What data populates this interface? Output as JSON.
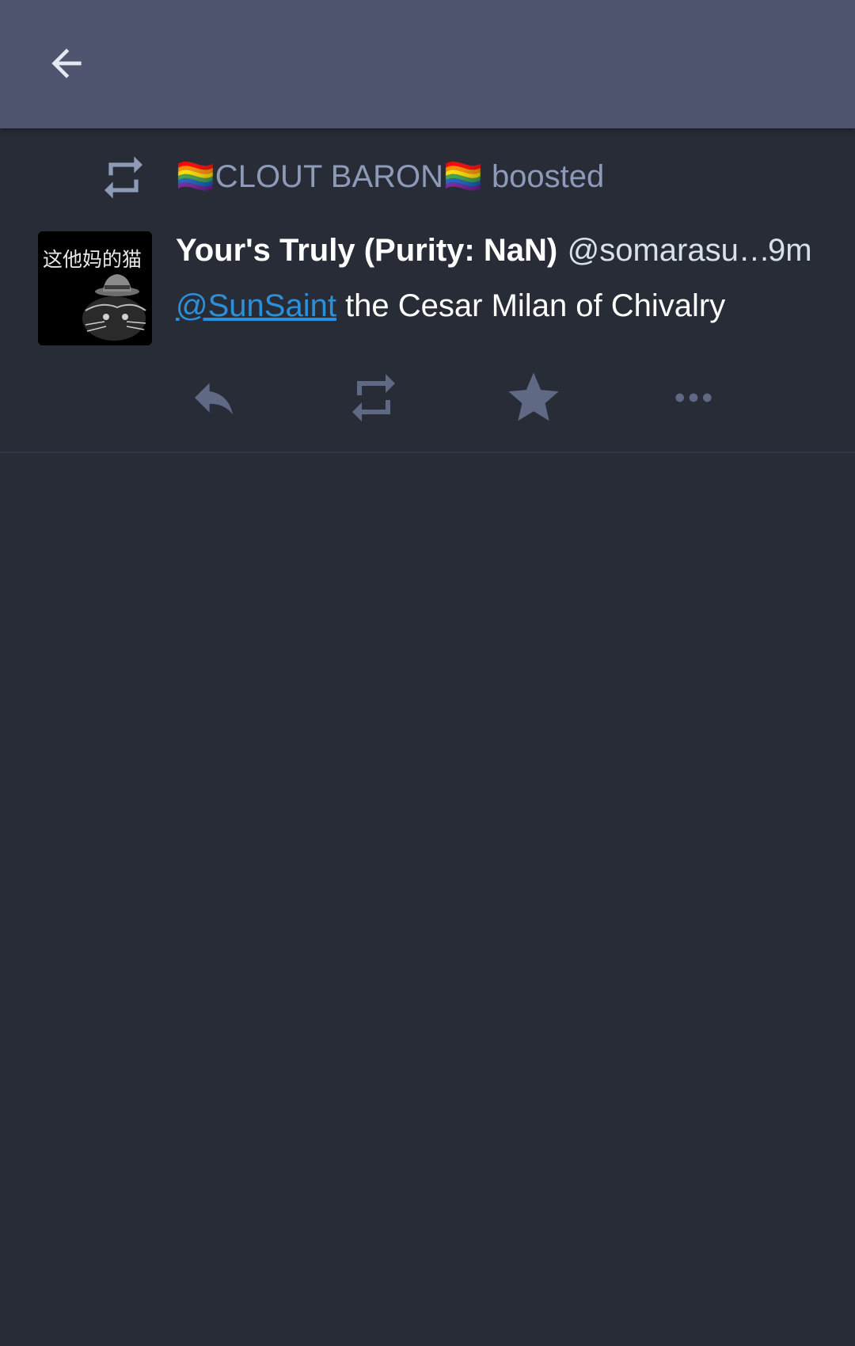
{
  "toolbar": {
    "back_icon": "arrow-left-icon"
  },
  "status": {
    "boost": {
      "icon": "retweet-icon",
      "booster_name": "🏳️‍🌈CLOUT BARON🏳️‍🌈",
      "label": "boosted"
    },
    "author": {
      "avatar_text": "这他妈的猫",
      "display_name": "Your's Truly (Purity: NaN)",
      "handle": "@somarasu…"
    },
    "time": "9m",
    "content": {
      "mention": "@SunSaint",
      "text": " the Cesar Milan of Chivalry"
    },
    "actions": {
      "reply_icon": "reply-icon",
      "reblog_icon": "retweet-icon",
      "favourite_icon": "star-icon",
      "more_icon": "more-horizontal-icon"
    }
  },
  "colors": {
    "toolbar_bg": "#4f556e",
    "page_bg": "#282c37",
    "muted_text": "#8d9ab8",
    "link": "#2b90d9",
    "icon": "#606984"
  }
}
